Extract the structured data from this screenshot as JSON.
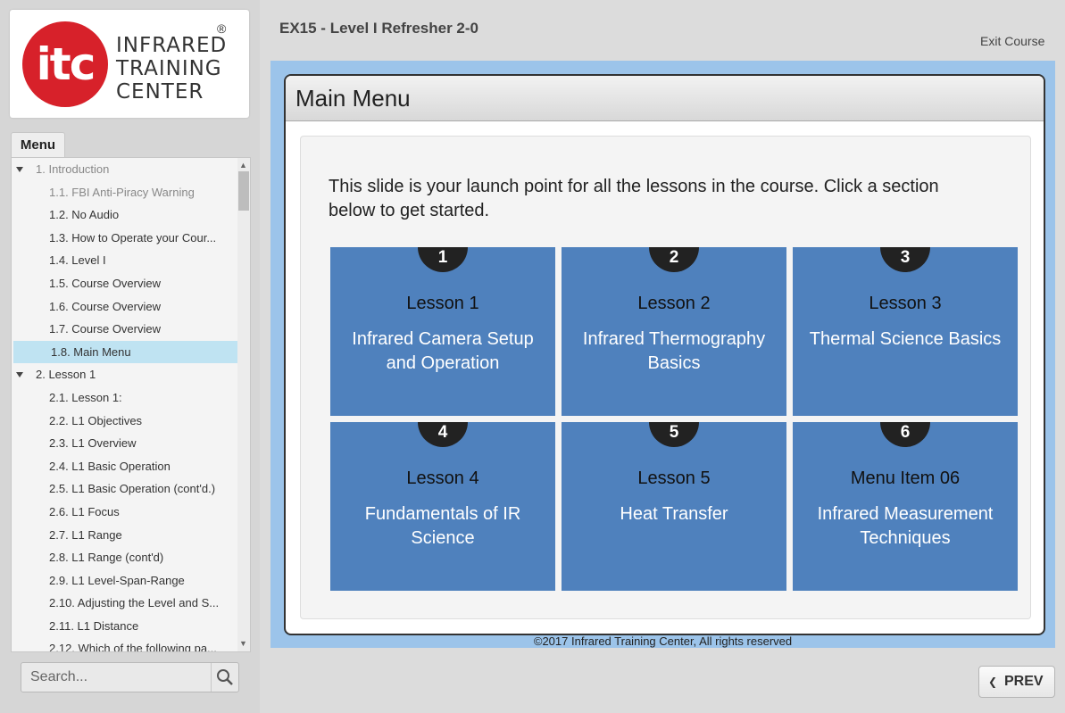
{
  "brand": {
    "logo_mark": "itc",
    "logo_lines": [
      "INFRARED",
      "TRAINING",
      "CENTER"
    ],
    "registered": "®",
    "brand_red": "#d7212a"
  },
  "sidebar": {
    "tab_label": "Menu",
    "items": [
      {
        "label": "1. Introduction",
        "type": "section"
      },
      {
        "label": "1.1. FBI Anti-Piracy Warning",
        "type": "sub"
      },
      {
        "label": "1.2. No Audio",
        "type": "sub"
      },
      {
        "label": "1.3. How to Operate your Cour...",
        "type": "sub"
      },
      {
        "label": "1.4. Level I",
        "type": "sub"
      },
      {
        "label": "1.5. Course Overview",
        "type": "sub"
      },
      {
        "label": "1.6. Course Overview",
        "type": "sub"
      },
      {
        "label": "1.7. Course Overview",
        "type": "sub"
      },
      {
        "label": "1.8. Main Menu",
        "type": "sub",
        "active": true
      },
      {
        "label": "2. Lesson 1",
        "type": "section"
      },
      {
        "label": "2.1. Lesson 1:",
        "type": "sub"
      },
      {
        "label": "2.2. L1 Objectives",
        "type": "sub"
      },
      {
        "label": "2.3. L1 Overview",
        "type": "sub"
      },
      {
        "label": "2.4. L1 Basic Operation",
        "type": "sub"
      },
      {
        "label": "2.5. L1 Basic Operation (cont'd.)",
        "type": "sub"
      },
      {
        "label": "2.6. L1 Focus",
        "type": "sub"
      },
      {
        "label": "2.7. L1 Range",
        "type": "sub"
      },
      {
        "label": "2.8. L1 Range (cont'd)",
        "type": "sub"
      },
      {
        "label": "2.9. L1 Level-Span-Range",
        "type": "sub"
      },
      {
        "label": "2.10. Adjusting the Level and S...",
        "type": "sub"
      },
      {
        "label": "2.11. L1 Distance",
        "type": "sub"
      },
      {
        "label": "2.12. Which of the following pa...",
        "type": "sub"
      }
    ],
    "search_placeholder": "Search..."
  },
  "header": {
    "course_title": "EX15 - Level I Refresher 2-0",
    "exit_label": "Exit Course"
  },
  "slide": {
    "title": "Main Menu",
    "intro": "This slide is your launch point for all the lessons in the course. Click a section below to get started.",
    "tiles": [
      {
        "number": "1",
        "lesson": "Lesson 1",
        "desc": "Infrared Camera Setup and Operation"
      },
      {
        "number": "2",
        "lesson": "Lesson 2",
        "desc": "Infrared Thermography Basics"
      },
      {
        "number": "3",
        "lesson": "Lesson 3",
        "desc": "Thermal Science Basics"
      },
      {
        "number": "4",
        "lesson": "Lesson 4",
        "desc": "Fundamentals of IR Science"
      },
      {
        "number": "5",
        "lesson": "Lesson 5",
        "desc": "Heat Transfer"
      },
      {
        "number": "6",
        "lesson": "Menu Item 06",
        "desc": "Infrared Measurement Techniques"
      }
    ],
    "tile_color": "#4f81bd"
  },
  "footer": {
    "copyright": "©2017 Infrared Training Center, All rights reserved",
    "prev_label": "PREV"
  }
}
